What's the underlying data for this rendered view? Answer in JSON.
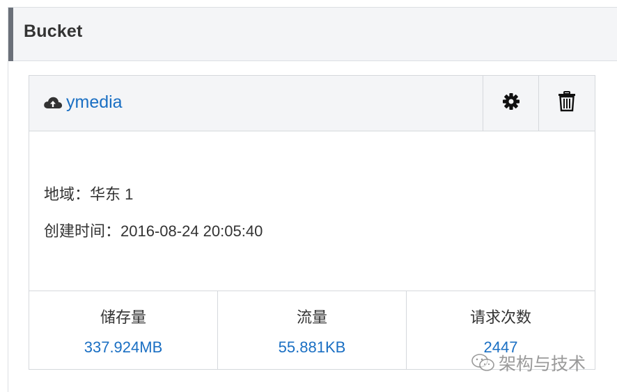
{
  "section": {
    "title": "Bucket"
  },
  "bucket": {
    "name": "ymedia",
    "icon": "cloud-upload-icon",
    "actions": {
      "settings_icon": "gear-icon",
      "delete_icon": "trash-icon"
    },
    "region": {
      "label": "地域：",
      "value": "华东 1"
    },
    "created": {
      "label": "创建时间：",
      "value": "2016-08-24 20:05:40"
    },
    "stats": [
      {
        "label": "储存量",
        "value": "337.924MB"
      },
      {
        "label": "流量",
        "value": "55.881KB"
      },
      {
        "label": "请求次数",
        "value": "2447"
      }
    ]
  },
  "watermark": {
    "text": "架构与技术",
    "icon": "wechat-icon"
  },
  "colors": {
    "link": "#1a6fc3",
    "header_bg": "#f4f5f7",
    "accent_bar": "#6b7079",
    "border": "#d5d8dc"
  }
}
